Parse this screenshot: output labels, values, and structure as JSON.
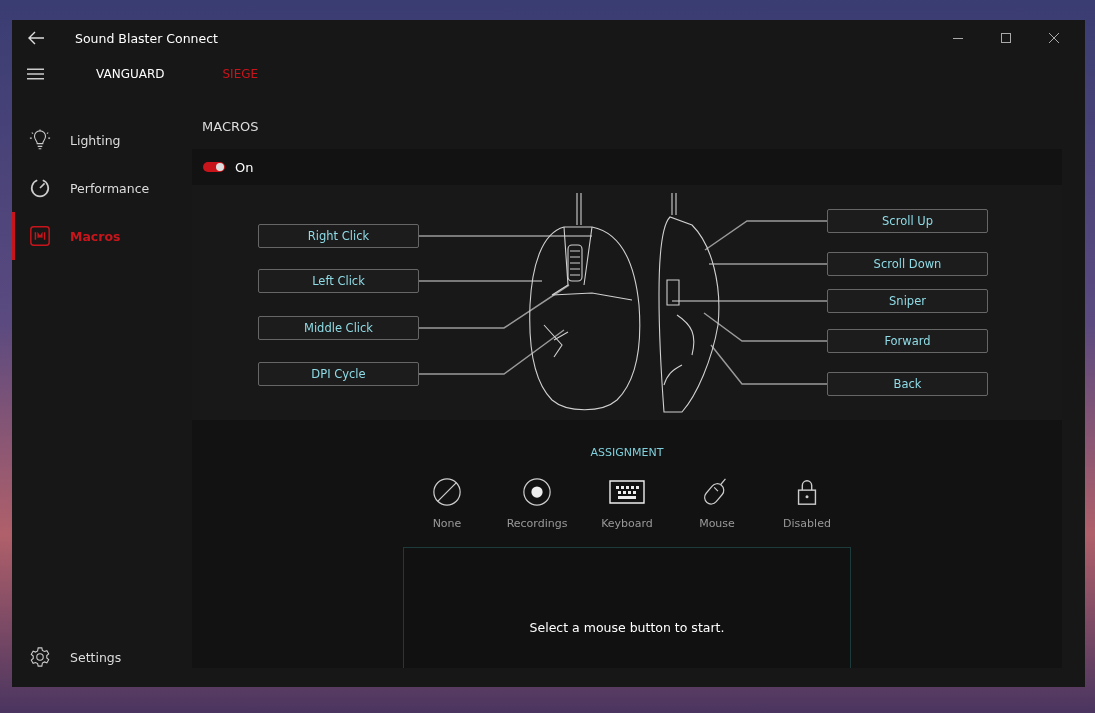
{
  "window": {
    "title": "Sound Blaster Connect"
  },
  "tabs": [
    {
      "label": "VANGUARD",
      "selected": false
    },
    {
      "label": "SIEGE",
      "selected": true
    }
  ],
  "sidebar": {
    "items": [
      {
        "label": "Lighting",
        "kind": "bulb",
        "selected": false
      },
      {
        "label": "Performance",
        "kind": "gauge",
        "selected": false
      },
      {
        "label": "Macros",
        "kind": "macro",
        "selected": true
      }
    ],
    "footer": {
      "label": "Settings"
    }
  },
  "page": {
    "title": "MACROS",
    "toggle": {
      "label": "On",
      "on": true
    },
    "left_buttons": [
      "Right Click",
      "Left Click",
      "Middle Click",
      "DPI Cycle"
    ],
    "right_buttons": [
      "Scroll Up",
      "Scroll Down",
      "Sniper",
      "Forward",
      "Back"
    ],
    "assignment": {
      "title": "ASSIGNMENT",
      "options": [
        {
          "label": "None",
          "kind": "none"
        },
        {
          "label": "Recordings",
          "kind": "record"
        },
        {
          "label": "Keyboard",
          "kind": "keyboard"
        },
        {
          "label": "Mouse",
          "kind": "mouse"
        },
        {
          "label": "Disabled",
          "kind": "lock"
        }
      ]
    },
    "prompt": "Select a mouse button to start."
  }
}
